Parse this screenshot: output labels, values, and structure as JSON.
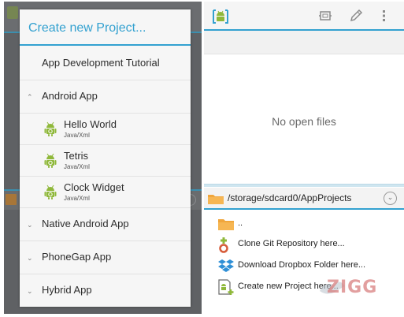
{
  "dialog": {
    "title": "Create new Project...",
    "tutorial_label": "App Development Tutorial",
    "groups": [
      {
        "label": "Android App",
        "expanded": true,
        "chevron": "chevron-up"
      },
      {
        "label": "Native Android App",
        "expanded": false,
        "chevron": "chevron-down"
      },
      {
        "label": "PhoneGap App",
        "expanded": false,
        "chevron": "chevron-down"
      },
      {
        "label": "Hybrid App",
        "expanded": false,
        "chevron": "chevron-down"
      }
    ],
    "items": [
      {
        "title": "Hello World",
        "subtitle": "Java/Xml",
        "icon": "android-robot-icon"
      },
      {
        "title": "Tetris",
        "subtitle": "Java/Xml",
        "icon": "android-robot-icon"
      },
      {
        "title": "Clock Widget",
        "subtitle": "Java/Xml",
        "icon": "android-robot-icon"
      }
    ]
  },
  "editor": {
    "empty_message": "No open files",
    "toolbar_icons": [
      "aide-logo-icon",
      "frame-icon",
      "pencil-icon",
      "overflow-menu-icon"
    ]
  },
  "file_browser": {
    "path": "/storage/sdcard0/AppProjects",
    "entries": [
      {
        "label": "..",
        "icon": "folder-icon"
      },
      {
        "label": "Clone Git Repository here...",
        "icon": "git-icon"
      },
      {
        "label": "Download Dropbox Folder here...",
        "icon": "dropbox-icon"
      },
      {
        "label": "Create new Project here...",
        "icon": "new-project-icon"
      }
    ]
  },
  "watermark": {
    "text": "ZIGG"
  },
  "colors": {
    "accent": "#33a1d0",
    "android_green": "#8fb83a",
    "folder": "#f0a63c",
    "scrim": "#5f6164"
  }
}
